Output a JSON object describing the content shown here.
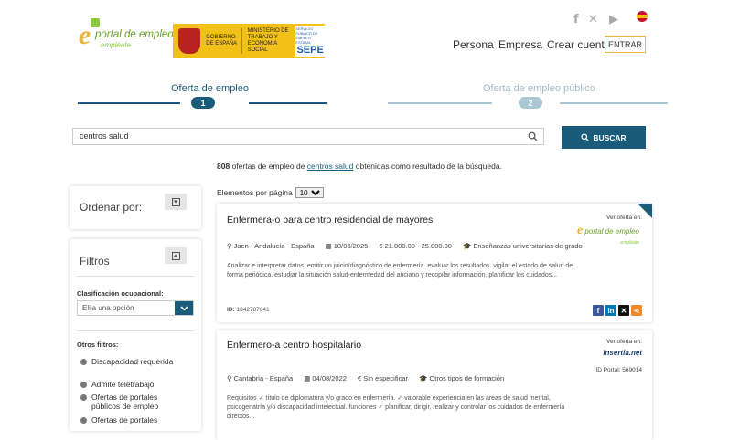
{
  "header": {
    "logo": {
      "letter": "e",
      "line1": "portal de empleo",
      "line2": "empléate"
    },
    "gov": {
      "col1": "GOBIERNO DE ESPAÑA",
      "col2": "MINISTERIO DE TRABAJO Y ECONOMÍA SOCIAL",
      "sepe_small": "SERVICIO PÚBLICO DE EMPLEO ESTATAL",
      "sepe": "SEPE"
    },
    "nav": [
      "Persona",
      "Empresa",
      "Crear cuenta"
    ],
    "login_label": "ENTRAR"
  },
  "tabs": [
    {
      "label": "Oferta de empleo",
      "number": "1",
      "color": "#1a5b7a"
    },
    {
      "label": "Oferta de empleo público",
      "number": "2",
      "color": "#a9c6d2"
    }
  ],
  "search": {
    "value": "centros salud",
    "button_label": "BUSCAR"
  },
  "results": {
    "count": "808",
    "prefix": "ofertas de empleo de",
    "query": "centros salud",
    "suffix": "obtenidas como resultado de la búsqueda."
  },
  "sidebar": {
    "order_title": "Ordenar por:",
    "filters_title": "Filtros",
    "occupational_label": "Clasificación ocupacional:",
    "select_placeholder": "Elija una opción",
    "other_filters_label": "Otros filtros:",
    "options": [
      "Discapacidad requerida",
      "Admite teletrabajo",
      "Ofertas de portales públicos de empleo",
      "Ofertas de portales"
    ]
  },
  "list": {
    "per_page_label": "Elementos por página",
    "per_page_value": "10",
    "jobs": [
      {
        "title": "Enfermera-o para centro residencial de mayores",
        "location": "Jaen - Andalucía - España",
        "date": "18/06/2025",
        "salary": "21.000.00 - 25.000.00",
        "education": "Enseñanzas universitarias de grado",
        "description": "Analizar e interpretar datos. emitir un juicio/diagnóstico de enfermería. evaluar los resultados. vigilar el estado de salud de forma periódica. estudiar la situación salud-enfermedad del anciano y recopilar información. planificar los cuidados...",
        "id_label": "ID:",
        "id": "1842787641",
        "source_label": "Ver oferta en:",
        "source_logo_line1": "portal de empleo",
        "source_logo_line2": "empléate"
      },
      {
        "title": "Enfermero-a centro hospitalario",
        "location": "Cantabria - España",
        "date": "04/08/2022",
        "salary": "Sin especificar",
        "education": "Otros tipos de formación",
        "description": "Requisitos ✓ título de diplomatura y/o grado en enfermería. ✓ valorable experiencia en las áreas de salud mental, psicogeriatría y/o discapacidad intelectual. funciones ✓ planificar, dirigir, realizar y controlar los cuidados de enfermería directos...",
        "source_label": "Ver oferta en:",
        "source_logo": "insertia.net",
        "portal_id": "ID Portal: 569014"
      }
    ]
  }
}
